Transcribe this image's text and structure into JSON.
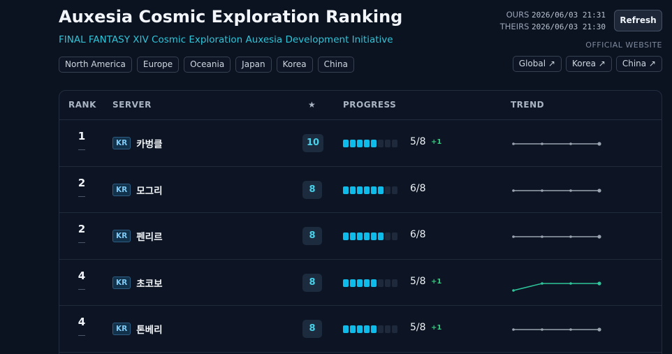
{
  "header": {
    "title": "Auxesia Cosmic Exploration Ranking",
    "subtitle": "FINAL FANTASY XIV Cosmic Exploration Auxesia Development Initiative",
    "regions": [
      "North America",
      "Europe",
      "Oceania",
      "Japan",
      "Korea",
      "China"
    ],
    "ours_label": "OURS",
    "ours_time": "2026/06/03 21:31",
    "theirs_label": "THEIRS",
    "theirs_time": "2026/06/03 21:30",
    "refresh_label": "Refresh",
    "official_label": "OFFICIAL WEBSITE",
    "official_links": [
      "Global ↗",
      "Korea ↗",
      "China ↗"
    ]
  },
  "table": {
    "columns": {
      "rank": "RANK",
      "server": "SERVER",
      "stars": "★",
      "progress": "PROGRESS",
      "trend": "TREND"
    },
    "total_segments": 8,
    "rows": [
      {
        "rank": "1",
        "rank_change": "—",
        "region": "KR",
        "server": "카벙클",
        "stars": "10",
        "progress_done": 5,
        "progress_text": "5/8",
        "delta": "+1",
        "trend": [
          0,
          0,
          0,
          0
        ],
        "trend_color": "#9aa3b0"
      },
      {
        "rank": "2",
        "rank_change": "—",
        "region": "KR",
        "server": "모그리",
        "stars": "8",
        "progress_done": 6,
        "progress_text": "6/8",
        "delta": "",
        "trend": [
          0,
          0,
          0,
          0
        ],
        "trend_color": "#9aa3b0"
      },
      {
        "rank": "2",
        "rank_change": "—",
        "region": "KR",
        "server": "펜리르",
        "stars": "8",
        "progress_done": 6,
        "progress_text": "6/8",
        "delta": "",
        "trend": [
          0,
          0,
          0,
          0
        ],
        "trend_color": "#9aa3b0"
      },
      {
        "rank": "4",
        "rank_change": "—",
        "region": "KR",
        "server": "초코보",
        "stars": "8",
        "progress_done": 5,
        "progress_text": "5/8",
        "delta": "+1",
        "trend": [
          -1,
          0,
          0,
          0
        ],
        "trend_color": "#2fc59a"
      },
      {
        "rank": "4",
        "rank_change": "—",
        "region": "KR",
        "server": "톤베리",
        "stars": "8",
        "progress_done": 5,
        "progress_text": "5/8",
        "delta": "+1",
        "trend": [
          0,
          0,
          0,
          0
        ],
        "trend_color": "#9aa3b0"
      }
    ]
  }
}
